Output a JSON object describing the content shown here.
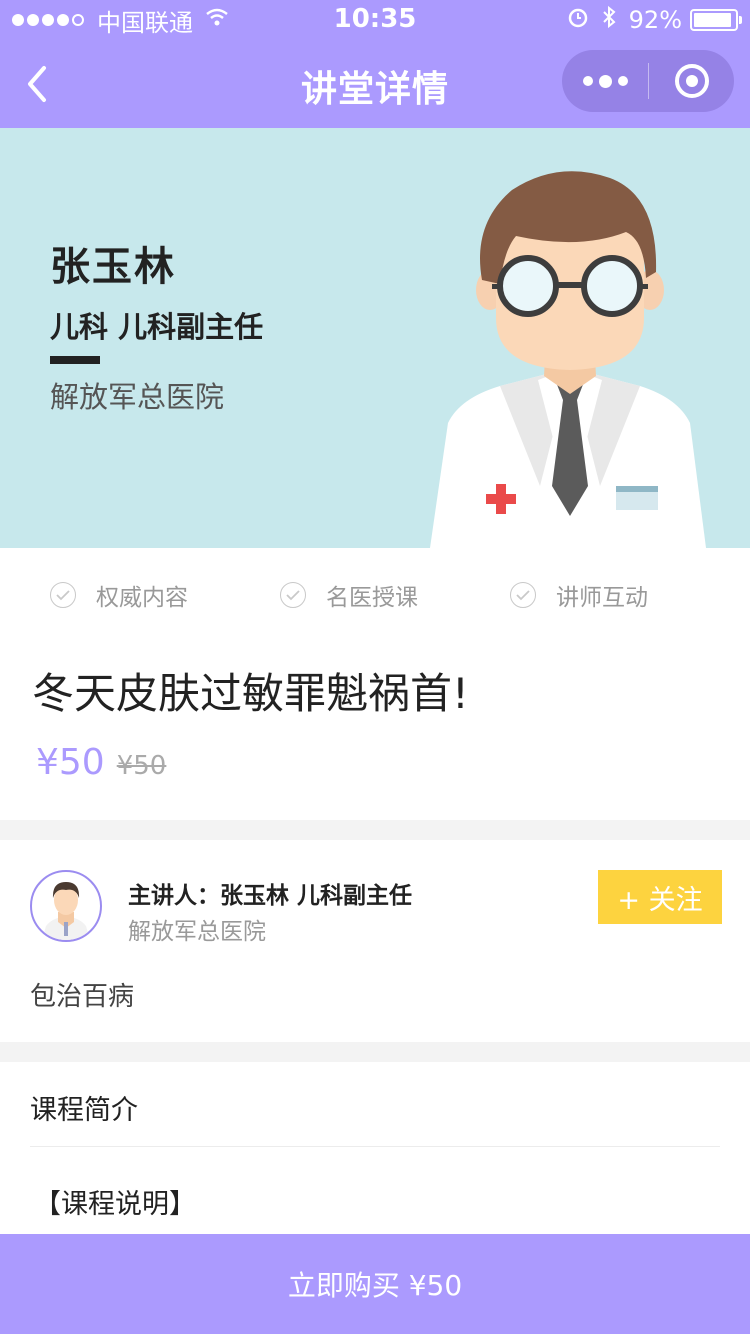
{
  "status_bar": {
    "carrier": "中国联通",
    "time": "10:35",
    "battery": "92%",
    "battery_level": 0.92
  },
  "nav": {
    "title": "讲堂详情"
  },
  "banner": {
    "doctor_name": "张玉林",
    "doctor_title": "儿科 儿科副主任",
    "hospital": "解放军总医院"
  },
  "features": [
    {
      "label": "权威内容"
    },
    {
      "label": "名医授课"
    },
    {
      "label": "讲师互动"
    }
  ],
  "course": {
    "title": "冬天皮肤过敏罪魁祸首!",
    "price": "¥50",
    "original_price": "¥50"
  },
  "lecturer": {
    "line": "主讲人：张玉林 儿科副主任",
    "hospital": "解放军总医院",
    "follow_label": "+ 关注",
    "description": "包治百病"
  },
  "intro": {
    "title": "课程简介",
    "subtitle": "【课程说明】"
  },
  "buy": {
    "label": "立即购买 ¥50"
  },
  "colors": {
    "accent": "#ab9afe",
    "banner_bg": "#c7e8ec",
    "follow_button": "#fdd33f"
  }
}
